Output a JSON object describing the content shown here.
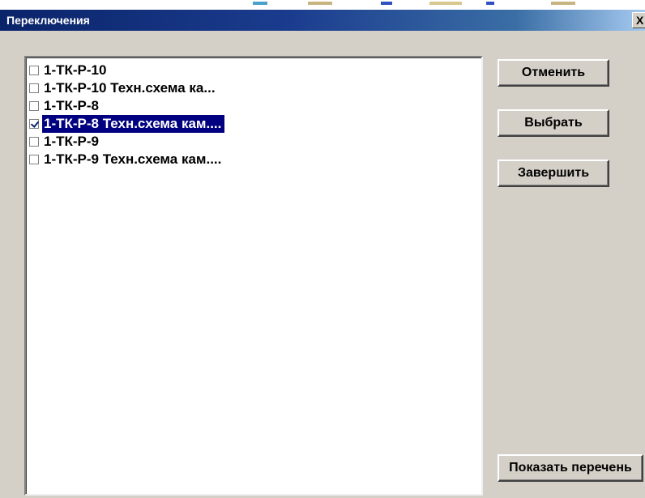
{
  "window": {
    "title": "Переключения",
    "close_glyph": "X"
  },
  "list": {
    "items": [
      {
        "label": "1-ТК-Р-10",
        "checked": false,
        "selected": false
      },
      {
        "label": "1-ТК-Р-10 Техн.схема ка...",
        "checked": false,
        "selected": false
      },
      {
        "label": "1-ТК-Р-8",
        "checked": false,
        "selected": false
      },
      {
        "label": "1-ТК-Р-8 Техн.схема кам....",
        "checked": true,
        "selected": true
      },
      {
        "label": "1-ТК-Р-9",
        "checked": false,
        "selected": false
      },
      {
        "label": "1-ТК-Р-9 Техн.схема кам....",
        "checked": false,
        "selected": false
      }
    ]
  },
  "buttons": {
    "cancel": "Отменить",
    "select": "Выбрать",
    "finish": "Завершить",
    "show_list": "Показать перечень"
  },
  "colors": {
    "titlebar_start": "#0a246a",
    "titlebar_end": "#a6caf0",
    "selection": "#000080",
    "dialog_face": "#d4d0c8"
  }
}
